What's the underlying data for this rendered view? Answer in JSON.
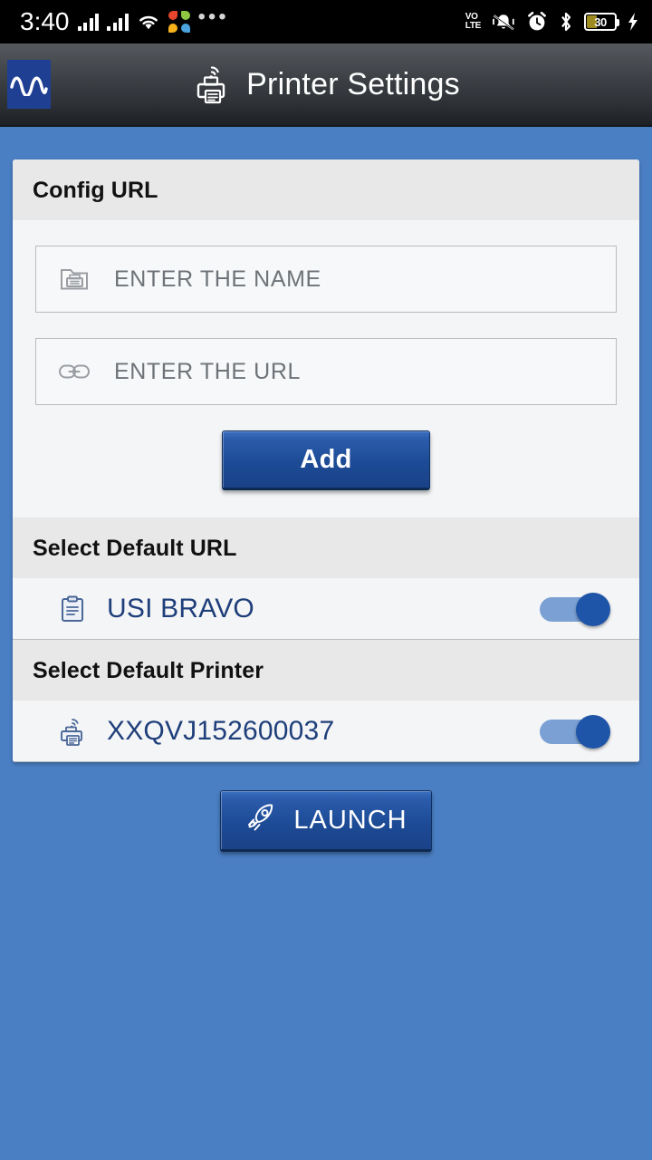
{
  "status_bar": {
    "time": "3:40",
    "network_label": "VO LTE",
    "volte_line1": "VO",
    "volte_line2": "LTE",
    "battery_level": "30",
    "icons": [
      "signal-bars-sim1",
      "signal-bars-sim2",
      "wifi-icon",
      "flower-app-icon",
      "overflow-dots-icon",
      "volte-icon",
      "mute-bell-icon",
      "alarm-clock-icon",
      "bluetooth-icon",
      "battery-icon",
      "charging-bolt-icon"
    ],
    "colors": {
      "background": "#000000",
      "foreground": "#ffffff",
      "battery_fill": "#9d8b20"
    }
  },
  "app_bar": {
    "title": "Printer Settings",
    "logo_name": "wave-logo",
    "icon_name": "wireless-printer-icon",
    "colors": {
      "logo_background": "#1f3f93",
      "title_color": "#ffffff"
    }
  },
  "config_section": {
    "header": "Config URL",
    "name_field": {
      "placeholder": "ENTER THE NAME",
      "value": "",
      "icon": "folder-printer-icon"
    },
    "url_field": {
      "placeholder": "ENTER THE URL",
      "value": "",
      "icon": "link-icon"
    },
    "add_button": "Add"
  },
  "default_url_section": {
    "header": "Select Default URL",
    "items": [
      {
        "label": "USI BRAVO",
        "icon": "clipboard-icon",
        "toggle_on": true
      }
    ]
  },
  "default_printer_section": {
    "header": "Select Default Printer",
    "items": [
      {
        "label": "XXQVJ152600037",
        "icon": "wireless-printer-icon",
        "toggle_on": true
      }
    ]
  },
  "footer": {
    "launch_button": "LAUNCH",
    "launch_icon": "rocket-icon"
  },
  "theme": {
    "page_background": "#4a7fc4",
    "card_background": "#f4f5f7",
    "section_header_background": "#e8e8e8",
    "accent_blue": "#1e55a8",
    "link_text": "#1f3f7a"
  }
}
